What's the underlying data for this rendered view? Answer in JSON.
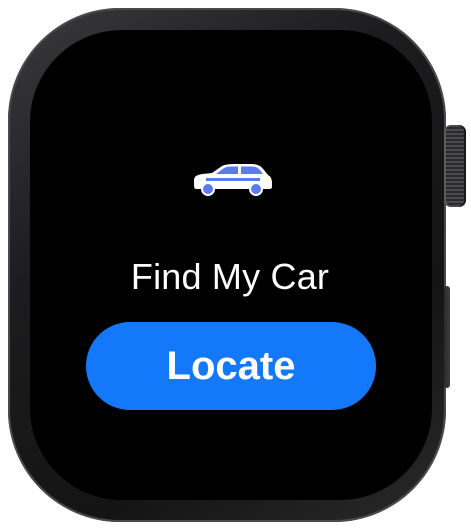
{
  "app": {
    "title": "Find My Car"
  },
  "icon": {
    "name": "car-icon",
    "body_color": "#ffffff",
    "accent_color": "#5b7cf0"
  },
  "actions": {
    "locate_label": "Locate"
  },
  "colors": {
    "screen_background": "#000000",
    "button_background": "#1478fa",
    "button_text": "#ffffff",
    "title_text": "#ffffff"
  }
}
